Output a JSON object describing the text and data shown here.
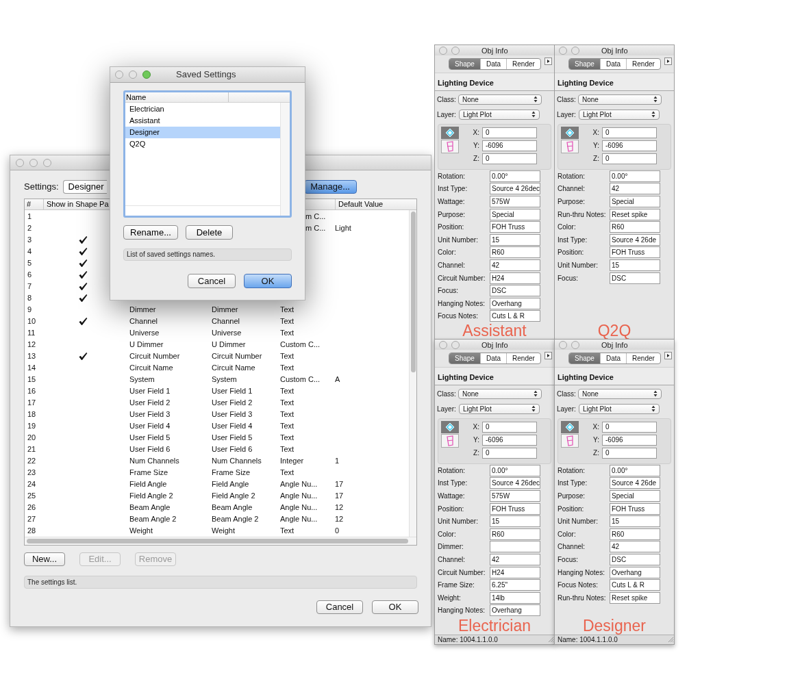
{
  "settings_dialog": {
    "settings_label": "Settings:",
    "settings_value": "Designer",
    "manage_button": "Manage...",
    "columns": [
      {
        "label": "#"
      },
      {
        "label": "Show in Shape Pa"
      },
      {
        "label": "Default Value"
      }
    ],
    "rows": [
      {
        "number": "1",
        "shown": false,
        "type": "m C..."
      },
      {
        "number": "2",
        "shown": false,
        "type": "m C...",
        "default": "Light"
      },
      {
        "number": "3",
        "shown": true
      },
      {
        "number": "4",
        "shown": true
      },
      {
        "number": "5",
        "shown": true
      },
      {
        "number": "6",
        "shown": true
      },
      {
        "number": "7",
        "shown": true
      },
      {
        "number": "8",
        "shown": true
      },
      {
        "number": "9",
        "shown": false,
        "name": "Dimmer",
        "field": "Dimmer",
        "type": "Text"
      },
      {
        "number": "10",
        "shown": true,
        "name": "Channel",
        "field": "Channel",
        "type": "Text"
      },
      {
        "number": "11",
        "shown": false,
        "name": "Universe",
        "field": "Universe",
        "type": "Text"
      },
      {
        "number": "12",
        "shown": false,
        "name": "U Dimmer",
        "field": "U Dimmer",
        "type": "Custom C..."
      },
      {
        "number": "13",
        "shown": true,
        "name": "Circuit Number",
        "field": "Circuit Number",
        "type": "Text"
      },
      {
        "number": "14",
        "shown": false,
        "name": "Circuit Name",
        "field": "Circuit Name",
        "type": "Text"
      },
      {
        "number": "15",
        "shown": false,
        "name": "System",
        "field": "System",
        "type": "Custom C...",
        "default": "A"
      },
      {
        "number": "16",
        "shown": false,
        "name": "User Field 1",
        "field": "User Field 1",
        "type": "Text"
      },
      {
        "number": "17",
        "shown": false,
        "name": "User Field 2",
        "field": "User Field 2",
        "type": "Text"
      },
      {
        "number": "18",
        "shown": false,
        "name": "User Field 3",
        "field": "User Field 3",
        "type": "Text"
      },
      {
        "number": "19",
        "shown": false,
        "name": "User Field 4",
        "field": "User Field 4",
        "type": "Text"
      },
      {
        "number": "20",
        "shown": false,
        "name": "User Field 5",
        "field": "User Field 5",
        "type": "Text"
      },
      {
        "number": "21",
        "shown": false,
        "name": "User Field 6",
        "field": "User Field 6",
        "type": "Text"
      },
      {
        "number": "22",
        "shown": false,
        "name": "Num Channels",
        "field": "Num Channels",
        "type": "Integer",
        "default": "1"
      },
      {
        "number": "23",
        "shown": false,
        "name": "Frame Size",
        "field": "Frame Size",
        "type": "Text"
      },
      {
        "number": "24",
        "shown": false,
        "name": "Field Angle",
        "field": "Field Angle",
        "type": "Angle Nu...",
        "default": "17"
      },
      {
        "number": "25",
        "shown": false,
        "name": "Field Angle 2",
        "field": "Field Angle 2",
        "type": "Angle Nu...",
        "default": "17"
      },
      {
        "number": "26",
        "shown": false,
        "name": "Beam Angle",
        "field": "Beam Angle",
        "type": "Angle Nu...",
        "default": "12"
      },
      {
        "number": "27",
        "shown": false,
        "name": "Beam Angle 2",
        "field": "Beam Angle 2",
        "type": "Angle Nu...",
        "default": "12"
      },
      {
        "number": "28",
        "shown": false,
        "name": "Weight",
        "field": "Weight",
        "type": "Text",
        "default": "0"
      }
    ],
    "buttons": [
      {
        "label": "New...",
        "disabled": false
      },
      {
        "label": "Edit...",
        "disabled": true
      },
      {
        "label": "Remove",
        "disabled": true
      }
    ],
    "status": "The settings list.",
    "footer_buttons": [
      "Cancel",
      "OK"
    ]
  },
  "saved_settings": {
    "title": "Saved Settings",
    "column": "Name",
    "items": [
      {
        "name": "Electrician",
        "selected": false
      },
      {
        "name": "Assistant",
        "selected": false
      },
      {
        "name": "Designer",
        "selected": true
      },
      {
        "name": "Q2Q",
        "selected": false
      }
    ],
    "buttons": [
      "Rename...",
      "Delete"
    ],
    "status": "List of saved settings names.",
    "footer_buttons": [
      {
        "label": "Cancel",
        "default": false
      },
      {
        "label": "OK",
        "default": true
      }
    ]
  },
  "obj_info_panels": [
    {
      "title": "Obj Info",
      "tabs": [
        {
          "label": "Shape",
          "selected": true
        },
        {
          "label": "Data",
          "selected": false
        },
        {
          "label": "Render",
          "selected": false
        }
      ],
      "heading": "Lighting Device",
      "class_label": "Class:",
      "class_value": "None",
      "layer_label": "Layer:",
      "layer_value": "Light Plot",
      "coordinates": [
        {
          "axis": "X:",
          "value": "0"
        },
        {
          "axis": "Y:",
          "value": "-6096"
        },
        {
          "axis": "Z:",
          "value": "0"
        }
      ],
      "fields": [
        {
          "label": "Rotation:",
          "value": "0.00°"
        },
        {
          "label": "Inst Type:",
          "value": "Source 4 26dec"
        },
        {
          "label": "Wattage:",
          "value": "575W"
        },
        {
          "label": "Purpose:",
          "value": "Special"
        },
        {
          "label": "Position:",
          "value": "FOH Truss"
        },
        {
          "label": "Unit Number:",
          "value": "15"
        },
        {
          "label": "Color:",
          "value": "R60"
        },
        {
          "label": "Channel:",
          "value": "42"
        },
        {
          "label": "Circuit Number:",
          "value": "H24"
        },
        {
          "label": "Focus:",
          "value": "DSC"
        },
        {
          "label": "Hanging Notes:",
          "value": "Overhang"
        },
        {
          "label": "Focus Notes:",
          "value": "Cuts L & R"
        }
      ],
      "caption": "Assistant"
    },
    {
      "title": "Obj Info",
      "tabs": [
        {
          "label": "Shape",
          "selected": true
        },
        {
          "label": "Data",
          "selected": false
        },
        {
          "label": "Render",
          "selected": false
        }
      ],
      "heading": "Lighting Device",
      "class_label": "Class:",
      "class_value": "None",
      "layer_label": "Layer:",
      "layer_value": "Light Plot",
      "coordinates": [
        {
          "axis": "X:",
          "value": "0"
        },
        {
          "axis": "Y:",
          "value": "-6096"
        },
        {
          "axis": "Z:",
          "value": "0"
        }
      ],
      "fields": [
        {
          "label": "Rotation:",
          "value": "0.00°"
        },
        {
          "label": "Channel:",
          "value": "42"
        },
        {
          "label": "Purpose:",
          "value": "Special"
        },
        {
          "label": "Run-thru Notes:",
          "value": "Reset spike"
        },
        {
          "label": "Color:",
          "value": "R60"
        },
        {
          "label": "Inst Type:",
          "value": "Source 4 26de"
        },
        {
          "label": "Position:",
          "value": "FOH Truss"
        },
        {
          "label": "Unit Number:",
          "value": "15"
        },
        {
          "label": "Focus:",
          "value": "DSC"
        }
      ],
      "caption": "Q2Q"
    },
    {
      "title": "Obj Info",
      "tabs": [
        {
          "label": "Shape",
          "selected": true
        },
        {
          "label": "Data",
          "selected": false
        },
        {
          "label": "Render",
          "selected": false
        }
      ],
      "heading": "Lighting Device",
      "class_label": "Class:",
      "class_value": "None",
      "layer_label": "Layer:",
      "layer_value": "Light Plot",
      "coordinates": [
        {
          "axis": "X:",
          "value": "0"
        },
        {
          "axis": "Y:",
          "value": "-6096"
        },
        {
          "axis": "Z:",
          "value": "0"
        }
      ],
      "fields": [
        {
          "label": "Rotation:",
          "value": "0.00°"
        },
        {
          "label": "Inst Type:",
          "value": "Source 4 26dec"
        },
        {
          "label": "Wattage:",
          "value": "575W"
        },
        {
          "label": "Position:",
          "value": "FOH Truss"
        },
        {
          "label": "Unit Number:",
          "value": "15"
        },
        {
          "label": "Color:",
          "value": "R60"
        },
        {
          "label": "Dimmer:"
        },
        {
          "label": "Channel:",
          "value": "42"
        },
        {
          "label": "Circuit Number:",
          "value": "H24"
        },
        {
          "label": "Frame Size:",
          "value": "6.25\""
        },
        {
          "label": "Weight:",
          "value": "14lb"
        },
        {
          "label": "Hanging Notes:",
          "value": "Overhang"
        }
      ],
      "caption": "Electrician",
      "footer": "Name: 1004.1.1.0.0"
    },
    {
      "title": "Obj Info",
      "tabs": [
        {
          "label": "Shape",
          "selected": true
        },
        {
          "label": "Data",
          "selected": false
        },
        {
          "label": "Render",
          "selected": false
        }
      ],
      "heading": "Lighting Device",
      "class_label": "Class:",
      "class_value": "None",
      "layer_label": "Layer:",
      "layer_value": "Light Plot",
      "coordinates": [
        {
          "axis": "X:",
          "value": "0"
        },
        {
          "axis": "Y:",
          "value": "-6096"
        },
        {
          "axis": "Z:",
          "value": "0"
        }
      ],
      "fields": [
        {
          "label": "Rotation:",
          "value": "0.00°"
        },
        {
          "label": "Inst Type:",
          "value": "Source 4 26de"
        },
        {
          "label": "Purpose:",
          "value": "Special"
        },
        {
          "label": "Position:",
          "value": "FOH Truss"
        },
        {
          "label": "Unit Number:",
          "value": "15"
        },
        {
          "label": "Color:",
          "value": "R60"
        },
        {
          "label": "Channel:",
          "value": "42"
        },
        {
          "label": "Focus:",
          "value": "DSC"
        },
        {
          "label": "Hanging Notes:",
          "value": "Overhang"
        },
        {
          "label": "Focus Notes:",
          "value": "Cuts L & R"
        },
        {
          "label": "Run-thru Notes:",
          "value": "Reset spike"
        }
      ],
      "caption": "Designer",
      "footer": "Name: 1004.1.1.0.0"
    }
  ]
}
